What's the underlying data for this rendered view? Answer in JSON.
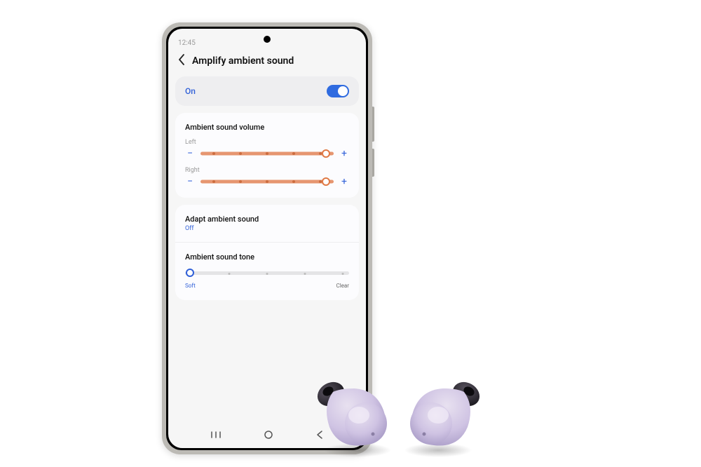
{
  "status": {
    "time": "12:45"
  },
  "header": {
    "title": "Amplify ambient sound"
  },
  "main_toggle": {
    "label": "On",
    "state": true
  },
  "volume": {
    "section_title": "Ambient sound volume",
    "left": {
      "label": "Left",
      "value": 5,
      "max": 5
    },
    "right": {
      "label": "Right",
      "value": 5,
      "max": 5
    },
    "minus": "−",
    "plus": "+"
  },
  "adapt": {
    "title": "Adapt ambient sound",
    "status": "Off"
  },
  "tone": {
    "title": "Ambient sound tone",
    "left_label": "Soft",
    "right_label": "Clear",
    "value": 0,
    "max": 4
  },
  "nav": {
    "recents": "|||",
    "home": "○",
    "back": "‹"
  },
  "colors": {
    "accent": "#2f5fd8",
    "slider": "#e69670"
  }
}
